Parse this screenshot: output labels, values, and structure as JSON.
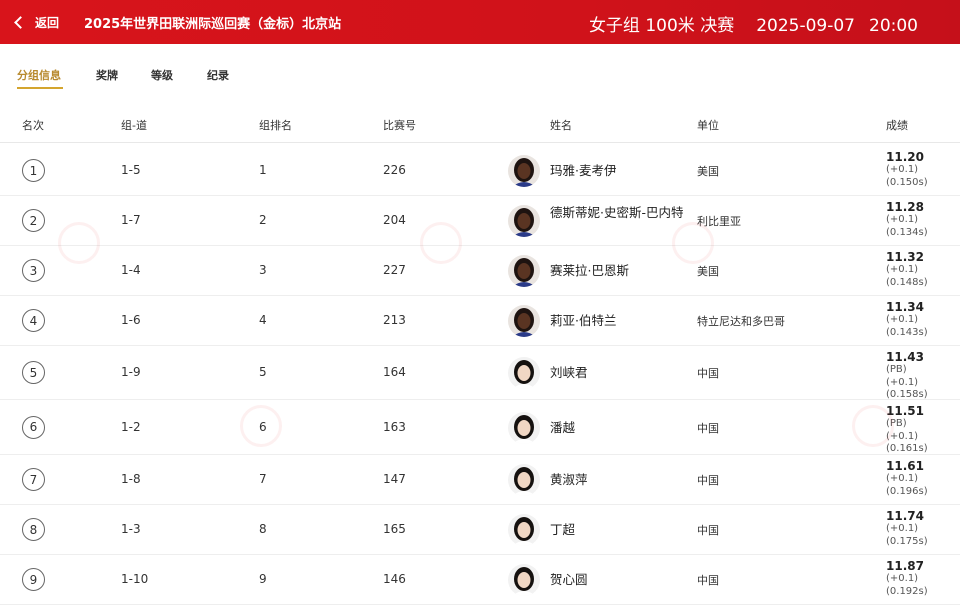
{
  "header": {
    "back_label": "返回",
    "event_title": "2025年世界田联洲际巡回赛（金标）北京站",
    "race_name": "女子组 100米 决赛",
    "date": "2025-09-07",
    "time": "20:00",
    "bg_color": "#d8141b"
  },
  "tabs": [
    {
      "label": "分组信息",
      "active": true
    },
    {
      "label": "奖牌",
      "active": false
    },
    {
      "label": "等级",
      "active": false
    },
    {
      "label": "纪录",
      "active": false
    }
  ],
  "columns": [
    "名次",
    "组-道",
    "组排名",
    "比赛号",
    "姓名",
    "单位",
    "成绩"
  ],
  "rows": [
    {
      "rank": "1",
      "lane": "1-5",
      "group_rank": "1",
      "bib": "226",
      "name": "玛雅·麦考伊",
      "unit": "美国",
      "time": "11.20",
      "notes": [
        "(+0.1)",
        "(0.150s)"
      ],
      "skin": "dark"
    },
    {
      "rank": "2",
      "lane": "1-7",
      "group_rank": "2",
      "bib": "204",
      "name": "德斯蒂妮·史密斯-巴内特",
      "unit": "利比里亚",
      "time": "11.28",
      "notes": [
        "(+0.1)",
        "(0.134s)"
      ],
      "skin": "dark"
    },
    {
      "rank": "3",
      "lane": "1-4",
      "group_rank": "3",
      "bib": "227",
      "name": "赛莱拉·巴恩斯",
      "unit": "美国",
      "time": "11.32",
      "notes": [
        "(+0.1)",
        "(0.148s)"
      ],
      "skin": "dark"
    },
    {
      "rank": "4",
      "lane": "1-6",
      "group_rank": "4",
      "bib": "213",
      "name": "莉亚·伯特兰",
      "unit": "特立尼达和多巴哥",
      "time": "11.34",
      "notes": [
        "(+0.1)",
        "(0.143s)"
      ],
      "skin": "dark"
    },
    {
      "rank": "5",
      "lane": "1-9",
      "group_rank": "5",
      "bib": "164",
      "name": "刘峡君",
      "unit": "中国",
      "time": "11.43",
      "notes": [
        "(PB)",
        "(+0.1)",
        "(0.158s)"
      ],
      "skin": "light"
    },
    {
      "rank": "6",
      "lane": "1-2",
      "group_rank": "6",
      "bib": "163",
      "name": "潘越",
      "unit": "中国",
      "time": "11.51",
      "notes": [
        "(PB)",
        "(+0.1)",
        "(0.161s)"
      ],
      "skin": "light"
    },
    {
      "rank": "7",
      "lane": "1-8",
      "group_rank": "7",
      "bib": "147",
      "name": "黄淑萍",
      "unit": "中国",
      "time": "11.61",
      "notes": [
        "(+0.1)",
        "(0.196s)"
      ],
      "skin": "light"
    },
    {
      "rank": "8",
      "lane": "1-3",
      "group_rank": "8",
      "bib": "165",
      "name": "丁超",
      "unit": "中国",
      "time": "11.74",
      "notes": [
        "(+0.1)",
        "(0.175s)"
      ],
      "skin": "light"
    },
    {
      "rank": "9",
      "lane": "1-10",
      "group_rank": "9",
      "bib": "146",
      "name": "贺心圆",
      "unit": "中国",
      "time": "11.87",
      "notes": [
        "(+0.1)",
        "(0.192s)"
      ],
      "skin": "light"
    }
  ]
}
